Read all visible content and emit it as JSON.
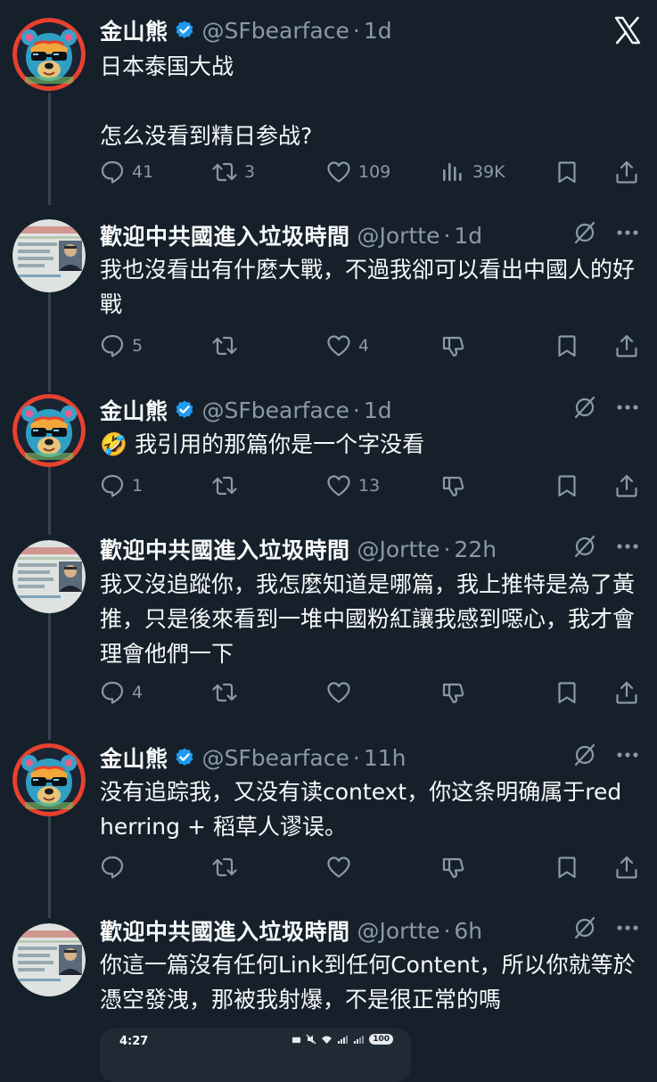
{
  "colors": {
    "background": "#15202b",
    "text": "#f7f9f9",
    "muted": "#8b98a5",
    "thread_line": "#38444d",
    "verified": "#1d9bf0"
  },
  "close_icon": "x-logo-icon",
  "tweets": [
    {
      "name": "金山熊",
      "verified": true,
      "handle": "@SFbearface",
      "separator": "·",
      "time": "1d",
      "text": "日本泰国大战\n\n怎么没看到精日参战?",
      "reply_count": "41",
      "retweet_count": "3",
      "like_count": "109",
      "view_count": "39K"
    },
    {
      "name": "歡迎中共國進入垃圾時間",
      "verified": false,
      "handle": "@Jortte",
      "separator": "·",
      "time": "1d",
      "text": "我也沒看出有什麼大戰，不過我卻可以看出中國人的好戰",
      "reply_count": "5",
      "retweet_count": "",
      "like_count": "4"
    },
    {
      "name": "金山熊",
      "verified": true,
      "handle": "@SFbearface",
      "separator": "·",
      "time": "1d",
      "text": "🤣 我引用的那篇你是一个字没看",
      "reply_count": "1",
      "retweet_count": "",
      "like_count": "13"
    },
    {
      "name": "歡迎中共國進入垃圾時間",
      "verified": false,
      "handle": "@Jortte",
      "separator": "·",
      "time": "22h",
      "text": "我又沒追蹤你，我怎麼知道是哪篇，我上推特是為了黃推，只是後來看到一堆中國粉紅讓我感到噁心，我才會理會他們一下",
      "reply_count": "4",
      "retweet_count": "",
      "like_count": ""
    },
    {
      "name": "金山熊",
      "verified": true,
      "handle": "@SFbearface",
      "separator": "·",
      "time": "11h",
      "text": "没有追踪我，又没有读context，你这条明确属于red herring + 稻草人谬误。",
      "reply_count": "",
      "retweet_count": "",
      "like_count": ""
    },
    {
      "name": "歡迎中共國進入垃圾時間",
      "verified": false,
      "handle": "@Jortte",
      "separator": "·",
      "time": "6h",
      "text": "你這一篇沒有任何Link到任何Content，所以你就等於憑空發洩，那被我射爆，不是很正常的嗎"
    }
  ],
  "embedded_screenshot": {
    "time": "4:27",
    "battery": "100"
  }
}
